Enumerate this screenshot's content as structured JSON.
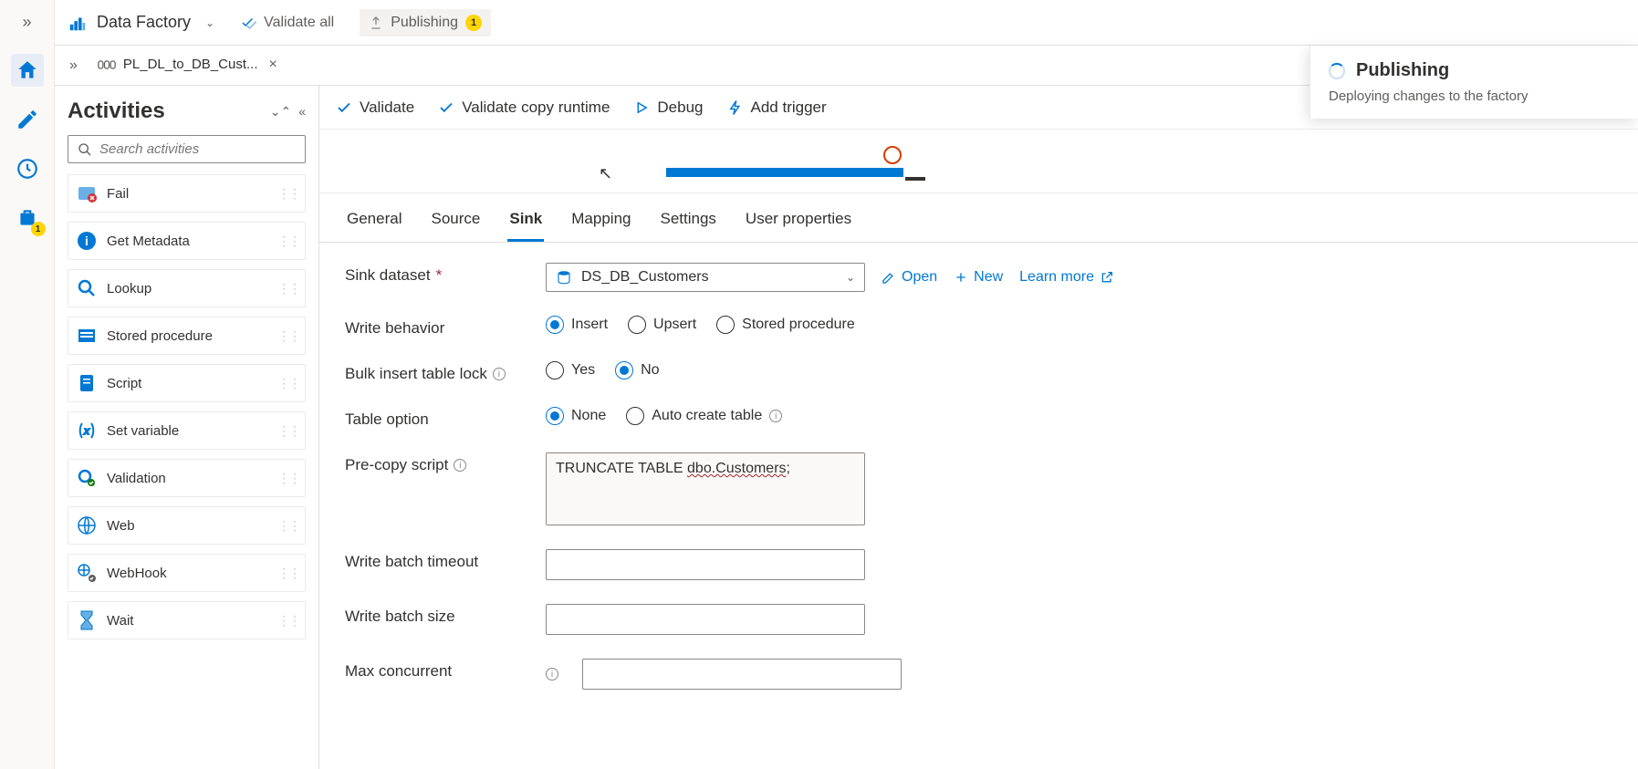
{
  "brand": {
    "name": "Data Factory"
  },
  "topbar": {
    "validate_all": "Validate all",
    "publishing": "Publishing",
    "publishing_count": "1"
  },
  "file_tab": {
    "label": "PL_DL_to_DB_Cust..."
  },
  "activities": {
    "title": "Activities",
    "search_placeholder": "Search activities",
    "items": [
      {
        "label": "Fail"
      },
      {
        "label": "Get Metadata"
      },
      {
        "label": "Lookup"
      },
      {
        "label": "Stored procedure"
      },
      {
        "label": "Script"
      },
      {
        "label": "Set variable"
      },
      {
        "label": "Validation"
      },
      {
        "label": "Web"
      },
      {
        "label": "WebHook"
      },
      {
        "label": "Wait"
      }
    ]
  },
  "editor_toolbar": {
    "validate": "Validate",
    "validate_copy": "Validate copy runtime",
    "debug": "Debug",
    "add_trigger": "Add trigger"
  },
  "prop_tabs": {
    "general": "General",
    "source": "Source",
    "sink": "Sink",
    "mapping": "Mapping",
    "settings": "Settings",
    "user_props": "User properties"
  },
  "sink": {
    "dataset_label": "Sink dataset",
    "dataset_value": "DS_DB_Customers",
    "open": "Open",
    "new": "New",
    "learn_more": "Learn more",
    "write_behavior_label": "Write behavior",
    "wb_insert": "Insert",
    "wb_upsert": "Upsert",
    "wb_sp": "Stored procedure",
    "bulk_lock_label": "Bulk insert table lock",
    "bl_yes": "Yes",
    "bl_no": "No",
    "table_option_label": "Table option",
    "to_none": "None",
    "to_auto": "Auto create table",
    "precopy_label": "Pre-copy script",
    "precopy_value_prefix": "TRUNCATE TABLE ",
    "precopy_value_mid": "dbo.Customers",
    "precopy_value_suffix": ";",
    "wbt_label": "Write batch timeout",
    "wbs_label": "Write batch size",
    "maxc_label": "Max concurrent"
  },
  "toast": {
    "title": "Publishing",
    "body": "Deploying changes to the factory"
  },
  "rail": {
    "briefcase_badge": "1"
  }
}
